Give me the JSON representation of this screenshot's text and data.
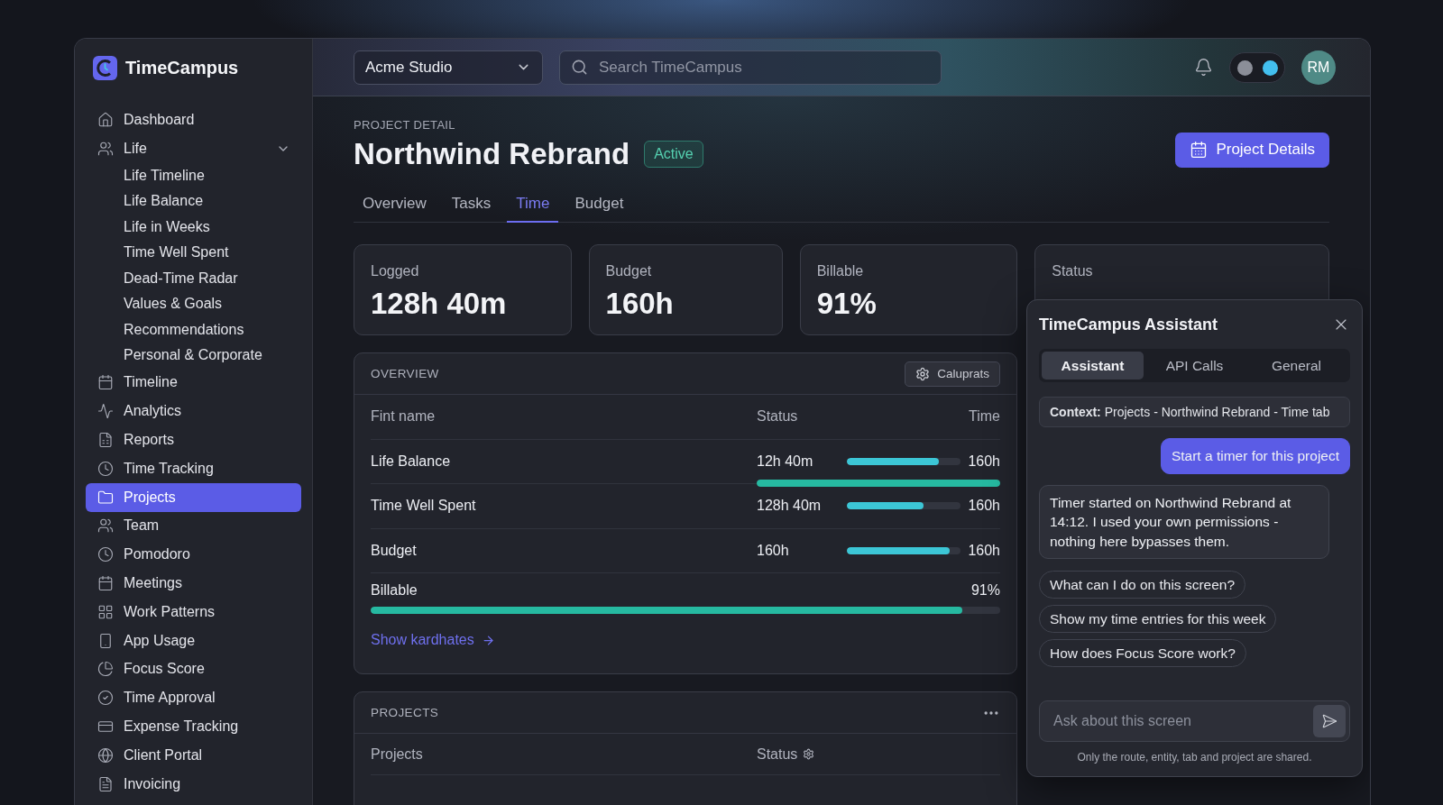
{
  "sidebar": {
    "brand": "TimeCampus",
    "items": [
      {
        "label": "Dashboard",
        "selected": false
      },
      {
        "label": "Life",
        "selected": false,
        "expanded": true,
        "children": [
          {
            "label": "Life Timeline",
            "selected": false
          },
          {
            "label": "Life Balance",
            "selected": false
          },
          {
            "label": "Life in Weeks",
            "selected": false
          },
          {
            "label": "Time Well Spent",
            "selected": false
          },
          {
            "label": "Dead-Time Radar",
            "selected": false
          },
          {
            "label": "Values & Goals",
            "selected": false
          },
          {
            "label": "Recommendations",
            "selected": false
          },
          {
            "label": "Personal & Corporate",
            "selected": false
          }
        ]
      },
      {
        "label": "Timeline",
        "selected": false
      },
      {
        "label": "Analytics",
        "selected": false
      },
      {
        "label": "Reports",
        "selected": false
      },
      {
        "label": "Time Tracking",
        "selected": false
      },
      {
        "label": "Projects",
        "selected": true
      },
      {
        "label": "Team",
        "selected": false
      },
      {
        "label": "Pomodoro",
        "selected": false
      },
      {
        "label": "Meetings",
        "selected": false
      },
      {
        "label": "Work Patterns",
        "selected": false
      },
      {
        "label": "App Usage",
        "selected": false
      },
      {
        "label": "Focus Score",
        "selected": false
      },
      {
        "label": "Time Approval",
        "selected": false
      },
      {
        "label": "Expense Tracking",
        "selected": false
      },
      {
        "label": "Client Portal",
        "selected": false
      },
      {
        "label": "Invoicing",
        "selected": false
      }
    ]
  },
  "topbar": {
    "workspace": "Acme Studio",
    "search": {
      "placeholder": "Search TimeCampus"
    },
    "theme_toggle": {
      "on": true
    },
    "avatar": "RM"
  },
  "header": {
    "eyebrow": "PROJECT DETAIL",
    "title": "Northwind Rebrand",
    "status": "Active",
    "action": "Project Details"
  },
  "tabs": [
    {
      "label": "Overview",
      "selected": false
    },
    {
      "label": "Tasks",
      "selected": false
    },
    {
      "label": "Time",
      "selected": true
    },
    {
      "label": "Budget",
      "selected": false
    }
  ],
  "stats": [
    {
      "label": "Logged",
      "value": "128h 40m"
    },
    {
      "label": "Budget",
      "value": "160h"
    },
    {
      "label": "Billable",
      "value": "91%"
    },
    {
      "label": "Status"
    }
  ],
  "overview": {
    "title": "OVERVIEW",
    "action": "Caluprats",
    "columns": [
      "Fint name",
      "Status",
      "Time"
    ],
    "rows": [
      {
        "name": "Life Balance",
        "value": "12h 40m",
        "bar": {
          "level": 0.81
        },
        "total": "160h",
        "underline": {
          "level": 1
        }
      },
      {
        "name": "Time Well Spent",
        "value": "128h 40m",
        "bar": {
          "level": 0.67
        },
        "total": "160h"
      },
      {
        "name": "Budget",
        "value": "160h",
        "bar": {
          "level": 0.9
        },
        "total": "160h"
      }
    ],
    "billable": {
      "label": "Billable",
      "value": "91%",
      "level": 0.94
    },
    "link": "Show kardhates"
  },
  "projects": {
    "title": "PROJECTS",
    "columns": [
      "Projects",
      "Status"
    ]
  },
  "assistant": {
    "title": "TimeCampus Assistant",
    "tabs": [
      {
        "label": "Assistant",
        "selected": true
      },
      {
        "label": "API Calls",
        "selected": false
      },
      {
        "label": "General",
        "selected": false
      }
    ],
    "context": "**Context:** Projects - Northwind Rebrand - Time tab",
    "messages": [
      {
        "kind": "user",
        "text": "Start a timer for this project"
      },
      {
        "kind": "bot",
        "text": "Timer started on Northwind Rebrand at 14:12. I used your own permissions - nothing here bypasses them."
      }
    ],
    "suggestions": [
      "What can I do on this screen?",
      "Show my time entries for this week",
      "How does Focus Score work?"
    ],
    "input": {
      "placeholder": "Ask about this screen"
    },
    "footnote": "Only the route, entity, tab and project are shared."
  }
}
